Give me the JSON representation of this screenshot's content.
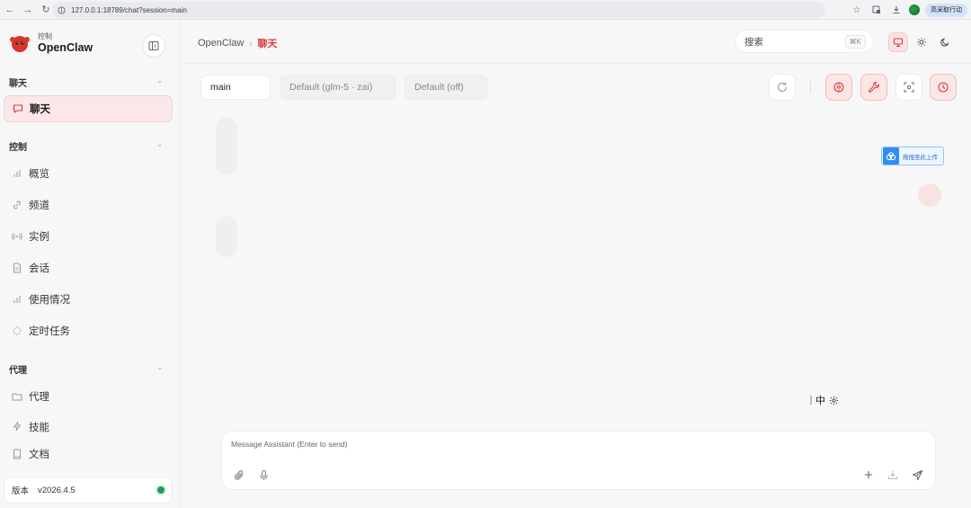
{
  "browser": {
    "url": "127.0.0.1:18789/chat?session=main",
    "profile_label": "高采取行动"
  },
  "sidebar": {
    "brand_sub": "控制",
    "brand_title": "OpenClaw",
    "sections": [
      {
        "label": "聊天",
        "items": [
          {
            "label": "聊天",
            "icon": "chat-bubble-icon",
            "active": true
          }
        ]
      },
      {
        "label": "控制",
        "items": [
          {
            "label": "概览",
            "icon": "bar-chart-icon"
          },
          {
            "label": "频道",
            "icon": "link-icon"
          },
          {
            "label": "实例",
            "icon": "broadcast-icon"
          },
          {
            "label": "会话",
            "icon": "document-icon"
          },
          {
            "label": "使用情况",
            "icon": "bar-chart-icon"
          },
          {
            "label": "定时任务",
            "icon": "loader-icon"
          }
        ]
      },
      {
        "label": "代理",
        "items": [
          {
            "label": "代理",
            "icon": "folder-icon"
          },
          {
            "label": "技能",
            "icon": "zap-icon"
          },
          {
            "label": "文档",
            "icon": "book-icon"
          }
        ]
      }
    ],
    "version_label": "版本",
    "version_value": "v2026.4.5"
  },
  "header": {
    "breadcrumb_root": "OpenClaw",
    "breadcrumb_sep": "›",
    "breadcrumb_current": "聊天",
    "search_label": "搜索",
    "search_shortcut": "⌘K"
  },
  "chat": {
    "session_chip": "main",
    "model_chip": "Default (glm-5 · zai)",
    "thinking_chip": "Default (off)",
    "baidu_badge": "拖拽至此上传",
    "ime_char": "中"
  },
  "composer": {
    "placeholder": "Message Assistant (Enter to send)"
  },
  "colors": {
    "accent": "#d93a3a",
    "accent_bg": "#fbe6e6",
    "status_online": "#1f9d55"
  }
}
